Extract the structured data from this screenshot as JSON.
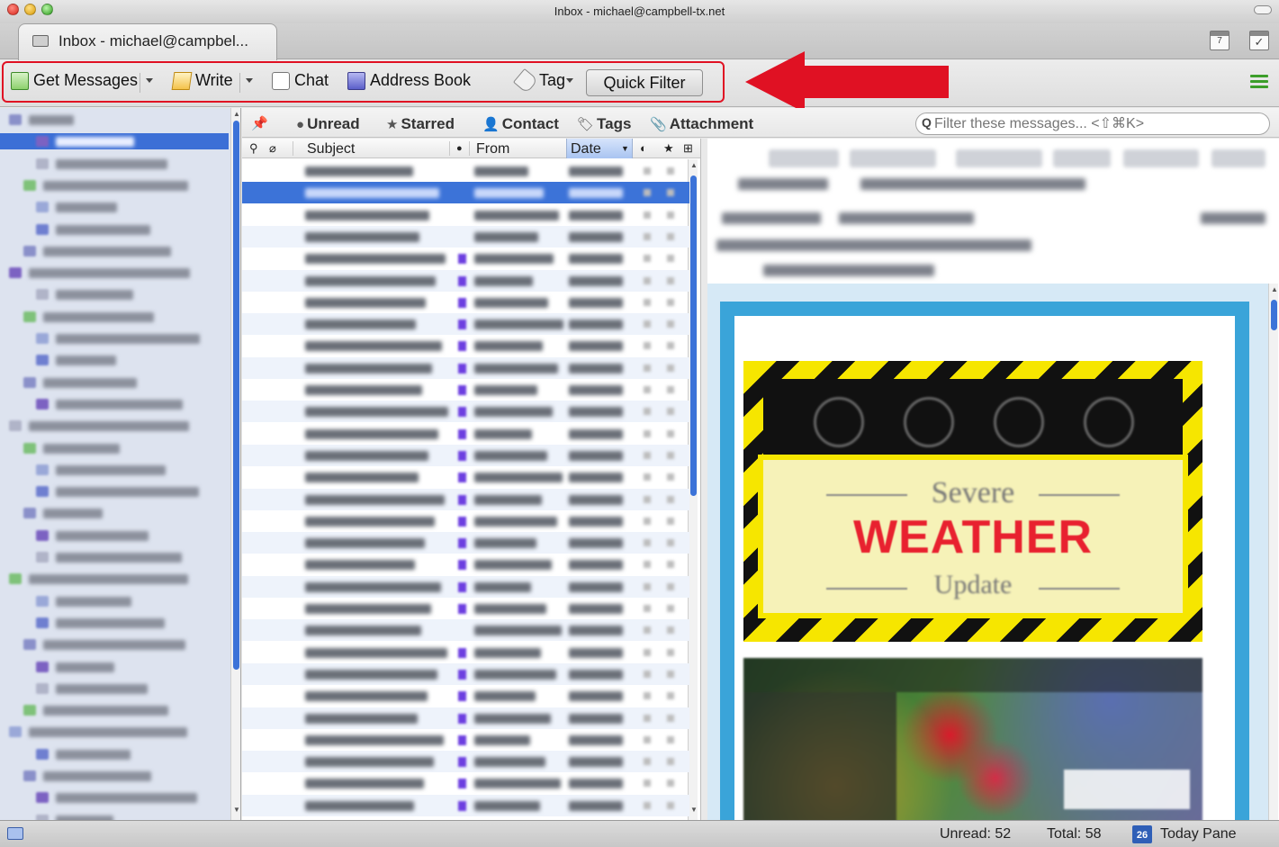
{
  "window": {
    "title": "Inbox - michael@campbell-tx.net"
  },
  "tab": {
    "label": "Inbox - michael@campbel..."
  },
  "toolbar": {
    "get_messages": "Get Messages",
    "write": "Write",
    "chat": "Chat",
    "address_book": "Address Book",
    "tag": "Tag",
    "quick_filter": "Quick Filter",
    "highlight_color": "#e01123"
  },
  "quickfilter": {
    "unread": "Unread",
    "starred": "Starred",
    "contact": "Contact",
    "tags": "Tags",
    "attachment": "Attachment",
    "search_placeholder": "Filter these messages... <⇧⌘K>"
  },
  "columns": {
    "subject": "Subject",
    "from": "From",
    "date": "Date"
  },
  "icons": {
    "get_messages": "get-messages-icon",
    "write": "write-icon",
    "chat": "chat-icon",
    "address_book": "address-book-icon",
    "tag": "tag-icon",
    "menu": "hamburger-menu-icon",
    "calendar": "calendar-icon",
    "tasks": "tasks-icon",
    "annotation": "red-arrow"
  },
  "message_body": {
    "banner_top": "Severe",
    "banner_main": "WEATHER",
    "banner_bottom": "Update"
  },
  "status": {
    "unread": "Unread: 52",
    "total": "Total: 58",
    "today_pane": "Today Pane",
    "today_day": "26"
  },
  "calendar": {
    "day": "7"
  }
}
